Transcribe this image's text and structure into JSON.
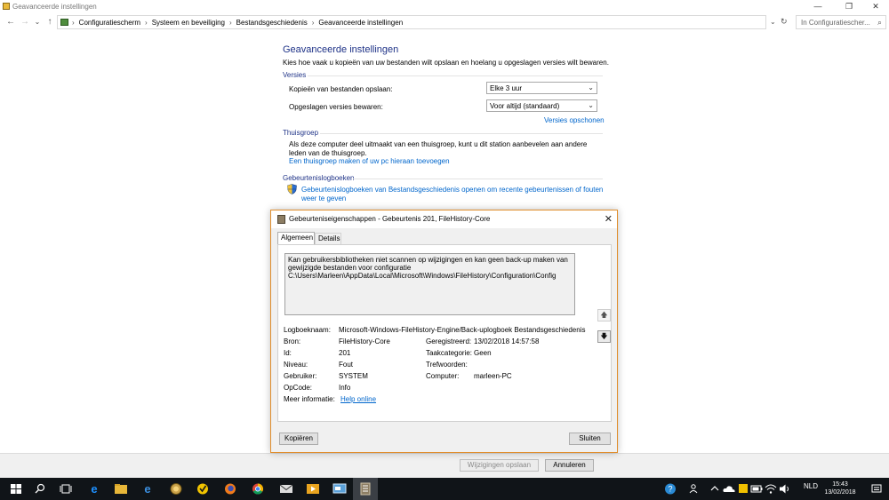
{
  "window": {
    "title": "Geavanceerde instellingen",
    "buttons": {
      "minimize": "—",
      "maximize": "❐",
      "close": "✕"
    }
  },
  "address": {
    "nav": {
      "back": "←",
      "forward": "→",
      "recent": "⌄",
      "up": "↑"
    },
    "breadcrumbs": [
      "Configuratiescherm",
      "Systeem en beveiliging",
      "Bestandsgeschiedenis",
      "Geavanceerde instellingen"
    ],
    "separator": "›",
    "search_placeholder": "In Configuratiescher...",
    "dropdown_glyph": "⌄",
    "refresh_glyph": "↻",
    "search_glyph": "⌕"
  },
  "main": {
    "title": "Geavanceerde instellingen",
    "description": "Kies hoe vaak u kopieën van uw bestanden wilt opslaan en hoelang u opgeslagen versies wilt bewaren.",
    "versions": {
      "heading": "Versies",
      "copies_label": "Kopieën van bestanden opslaan:",
      "copies_value": "Elke 3 uur",
      "keep_label": "Opgeslagen versies bewaren:",
      "keep_value": "Voor altijd (standaard)",
      "cleanup_link": "Versies opschonen"
    },
    "homegroup": {
      "heading": "Thuisgroep",
      "text": "Als deze computer deel uitmaakt van een thuisgroep, kunt u dit station aanbevelen aan andere leden van de thuisgroep.",
      "link": "Een thuisgroep maken of uw pc hieraan toevoegen"
    },
    "eventlogs": {
      "heading": "Gebeurtenislogboeken",
      "link": "Gebeurtenislogboeken van Bestandsgeschiedenis openen om recente gebeurtenissen of fouten weer te geven"
    },
    "footer": {
      "save": "Wijzigingen opslaan",
      "cancel": "Annuleren"
    }
  },
  "dialog": {
    "title": "Gebeurteniseigenschappen - Gebeurtenis 201, FileHistory-Core",
    "close": "✕",
    "tabs": [
      "Algemeen",
      "Details"
    ],
    "message": "Kan gebruikersbibliotheken niet scannen op wijzigingen en kan geen back-up maken van gewijzigde bestanden voor configuratie C:\\Users\\Marleen\\AppData\\Local\\Microsoft\\Windows\\FileHistory\\Configuration\\Config",
    "up_glyph": "🡅",
    "down_glyph": "🡇",
    "fields": {
      "log_name_label": "Logboeknaam:",
      "log_name": "Microsoft-Windows-FileHistory-Engine/Back-uplogboek Bestandsgeschiedenis",
      "source_label": "Bron:",
      "source": "FileHistory-Core",
      "logged_label": "Geregistreerd:",
      "logged": "13/02/2018 14:57:58",
      "id_label": "Id:",
      "id": "201",
      "task_label": "Taakcategorie:",
      "task": "Geen",
      "level_label": "Niveau:",
      "level": "Fout",
      "keywords_label": "Trefwoorden:",
      "keywords": "",
      "user_label": "Gebruiker:",
      "user": "SYSTEM",
      "computer_label": "Computer:",
      "computer": "marleen-PC",
      "opcode_label": "OpCode:",
      "opcode": "Info",
      "more_label": "Meer informatie:",
      "more_link": "Help online"
    },
    "buttons": {
      "copy": "Kopiëren",
      "close": "Sluiten"
    }
  },
  "taskbar": {
    "tray_language": "NLD",
    "time": "15:43",
    "date": "13/02/2018"
  }
}
